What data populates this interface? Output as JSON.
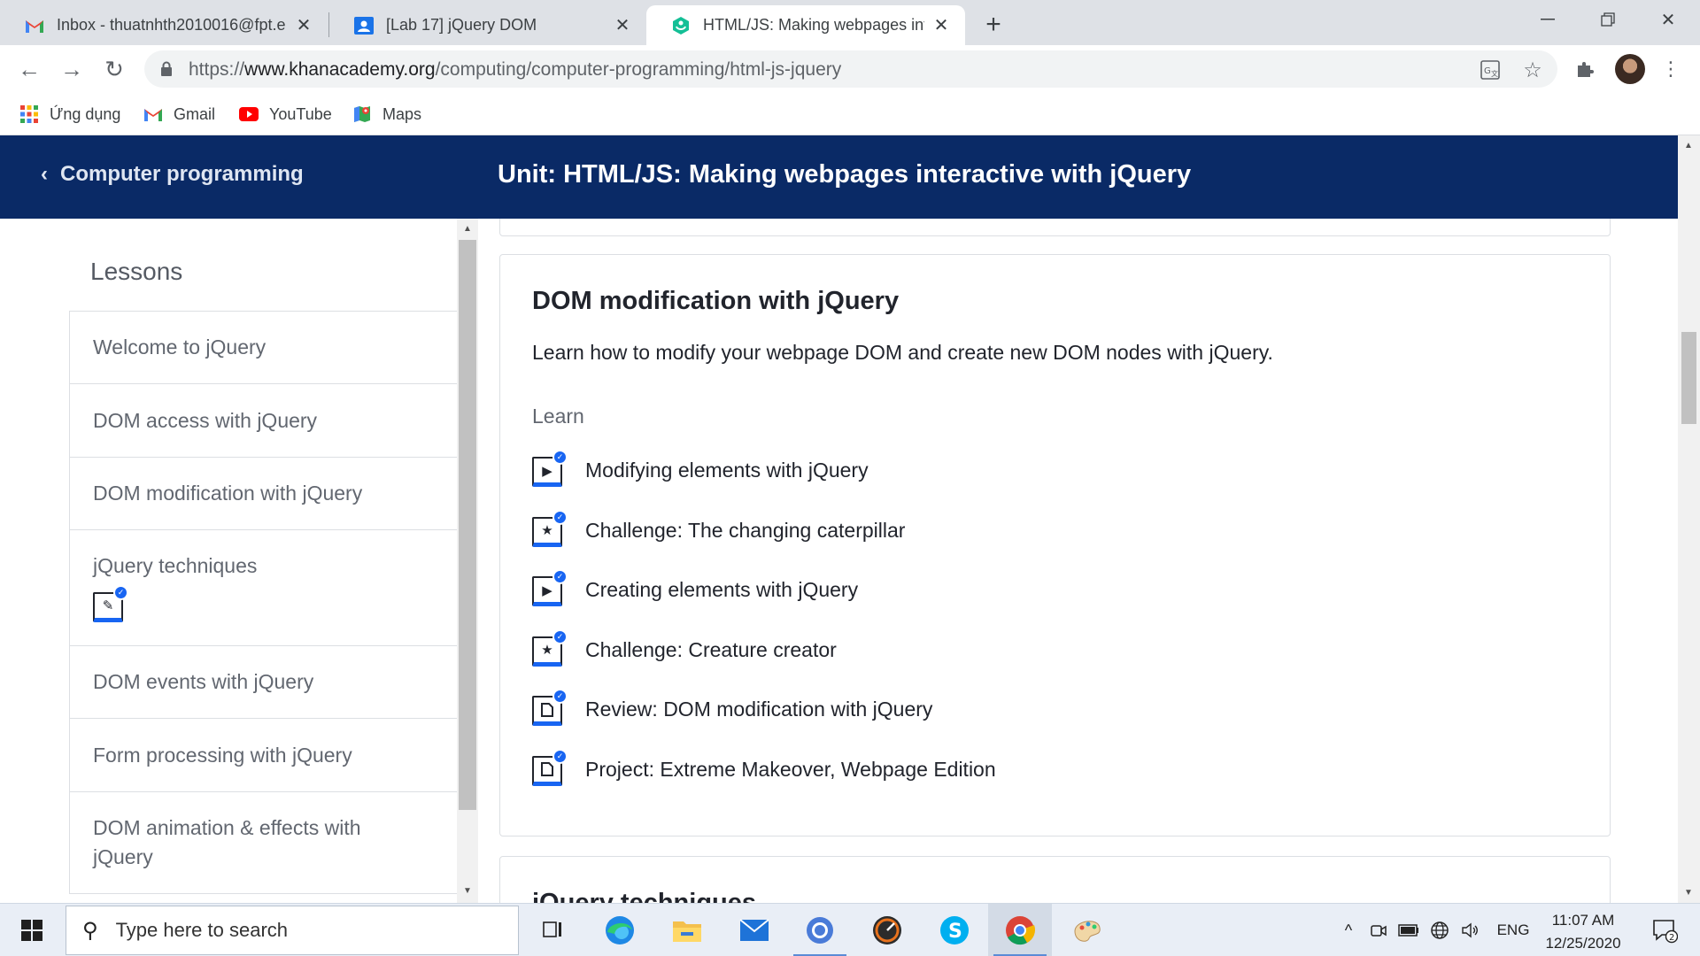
{
  "browser": {
    "tabs": [
      {
        "title": "Inbox - thuatnhth2010016@fpt.e",
        "icon": "gmail-icon",
        "active": false
      },
      {
        "title": "[Lab 17] jQuery DOM",
        "icon": "classroom-icon",
        "active": false
      },
      {
        "title": "HTML/JS: Making webpages inte",
        "icon": "khan-academy-icon",
        "active": true
      }
    ],
    "url_scheme": "https://",
    "url_host": "www.khanacademy.org",
    "url_path": "/computing/computer-programming/html-js-jquery",
    "bookmarks": [
      {
        "label": "Ứng dụng",
        "icon": "apps-grid-icon"
      },
      {
        "label": "Gmail",
        "icon": "gmail-icon"
      },
      {
        "label": "YouTube",
        "icon": "youtube-icon"
      },
      {
        "label": "Maps",
        "icon": "maps-icon"
      }
    ]
  },
  "header": {
    "back_label": "Computer programming",
    "unit_title": "Unit: HTML/JS: Making webpages interactive with jQuery"
  },
  "sidebar": {
    "title": "Lessons",
    "lessons": [
      {
        "label": "Welcome to jQuery"
      },
      {
        "label": "DOM access with jQuery"
      },
      {
        "label": "DOM modification with jQuery"
      },
      {
        "label": "jQuery techniques",
        "has_badge": true
      },
      {
        "label": "DOM events with jQuery"
      },
      {
        "label": "Form processing with jQuery"
      },
      {
        "label": "DOM animation & effects with jQuery"
      }
    ]
  },
  "main": {
    "section_title": "DOM modification with jQuery",
    "description": "Learn how to modify your webpage DOM and create new DOM nodes with jQuery.",
    "learn_label": "Learn",
    "items": [
      {
        "label": "Modifying elements with jQuery",
        "kind": "video",
        "completed": true
      },
      {
        "label": "Challenge: The changing caterpillar",
        "kind": "challenge",
        "completed": true
      },
      {
        "label": "Creating elements with jQuery",
        "kind": "video",
        "completed": true
      },
      {
        "label": "Challenge: Creature creator",
        "kind": "challenge",
        "completed": true
      },
      {
        "label": "Review: DOM modification with jQuery",
        "kind": "article",
        "completed": true
      },
      {
        "label": "Project: Extreme Makeover, Webpage Edition",
        "kind": "project",
        "completed": true
      }
    ],
    "next_section_title": "jQuery techniques"
  },
  "taskbar": {
    "search_placeholder": "Type here to search",
    "language": "ENG",
    "time": "11:07 AM",
    "date": "12/25/2020",
    "notification_count": "2"
  },
  "colors": {
    "header_bg": "#0a2a66",
    "accent_blue": "#1865f2",
    "tab_strip": "#dee1e6"
  }
}
